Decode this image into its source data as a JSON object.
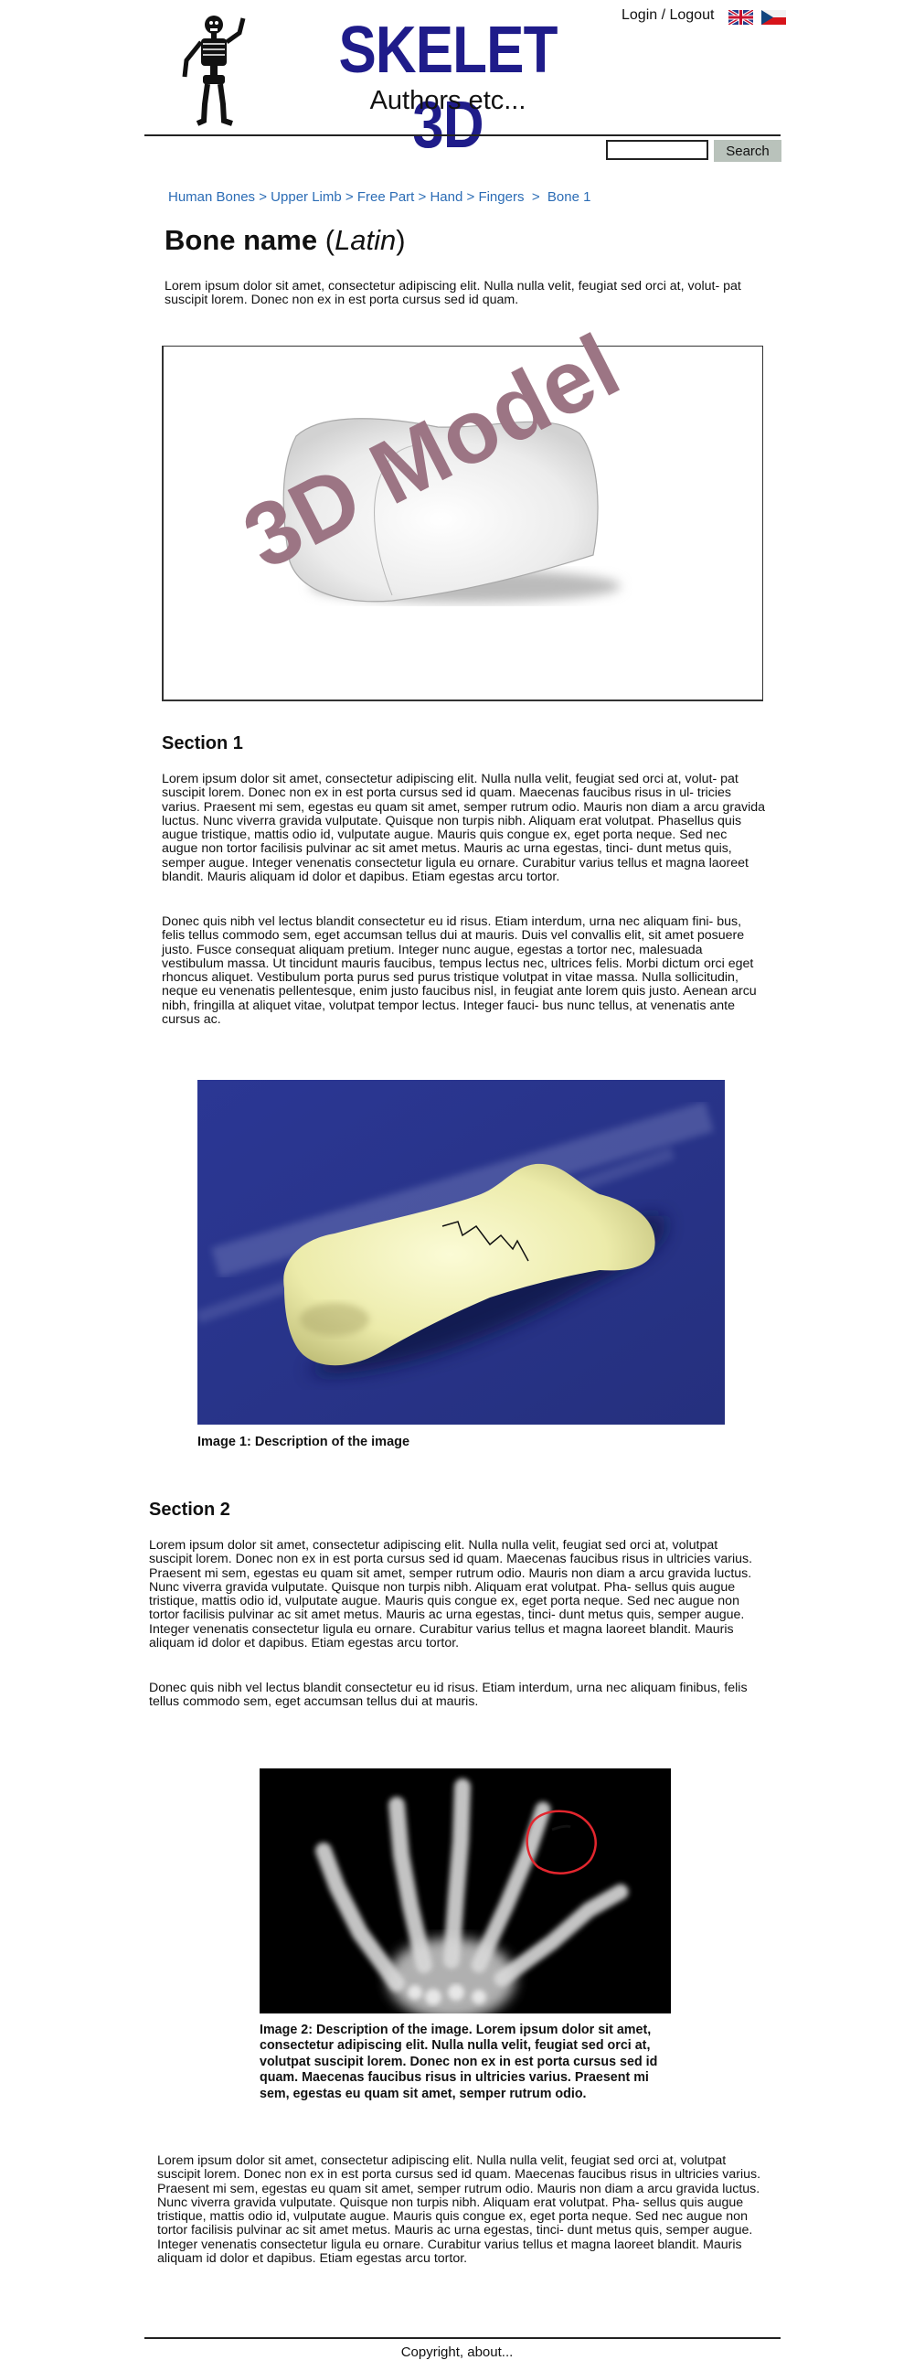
{
  "header": {
    "site_title": "SKELET 3D",
    "subtitle": "Authors etc...",
    "login_label": "Login / Logout",
    "languages": [
      "english-flag-icon",
      "czech-flag-icon"
    ]
  },
  "search": {
    "value": "",
    "placeholder": "",
    "button_label": "Search"
  },
  "breadcrumb": {
    "items": [
      "Human Bones",
      "Upper Limb",
      "Free Part",
      "Hand",
      "Fingers",
      "Bone 1"
    ],
    "separator": ">"
  },
  "bone": {
    "name": "Bone name",
    "latin": "Latin",
    "intro": "Lorem ipsum dolor sit amet, consectetur adipiscing elit. Nulla nulla velit, feugiat sed orci at, volut- pat suscipit lorem. Donec non ex in est porta cursus sed id quam."
  },
  "model": {
    "label": "3D Model"
  },
  "section1": {
    "heading": "Section 1",
    "paragraphs": [
      " Lorem ipsum dolor sit amet, consectetur adipiscing elit. Nulla nulla velit, feugiat sed orci at, volut- pat suscipit lorem. Donec non ex in est porta cursus sed id quam. Maecenas faucibus risus in ul- tricies varius. Praesent mi sem, egestas eu quam sit amet, semper rutrum odio. Mauris non diam a arcu gravida luctus. Nunc viverra gravida vulputate. Quisque non turpis nibh. Aliquam erat volutpat. Phasellus quis augue tristique, mattis odio id, vulputate augue. Mauris quis congue ex, eget porta neque. Sed nec augue non tortor facilisis pulvinar ac sit amet metus. Mauris ac urna egestas, tinci- dunt metus quis, semper augue. Integer venenatis consectetur ligula eu ornare. Curabitur varius tellus et magna laoreet blandit. Mauris aliquam id dolor et dapibus. Etiam egestas arcu tortor.",
      "Donec quis nibh vel lectus blandit consectetur eu id risus. Etiam interdum, urna nec aliquam fini- bus, felis tellus commodo sem, eget accumsan tellus dui at mauris. Duis vel convallis elit, sit amet posuere justo. Fusce consequat aliquam pretium. Integer nunc augue, egestas a tortor nec, malesuada vestibulum massa. Ut tincidunt mauris faucibus, tempus lectus nec, ultrices felis. Morbi dictum orci eget rhoncus aliquet. Vestibulum porta purus sed purus tristique volutpat in vitae massa. Nulla sollicitudin, neque eu venenatis pellentesque, enim justo faucibus nisl, in feugiat ante lorem quis justo. Aenean arcu nibh, fringilla at aliquet vitae, volutpat tempor lectus. Integer fauci- bus nunc tellus, at venenatis ante cursus ac."
    ],
    "image_caption": "Image 1: Description of the image"
  },
  "section2": {
    "heading": "Section 2",
    "paragraphs": [
      " Lorem ipsum dolor sit amet, consectetur adipiscing elit. Nulla nulla velit, feugiat sed orci at, volutpat suscipit lorem. Donec non ex in est porta cursus sed id quam. Maecenas faucibus risus in ultricies varius. Praesent mi sem, egestas eu quam sit amet, semper rutrum odio. Mauris non diam a arcu gravida luctus. Nunc viverra gravida vulputate. Quisque non turpis nibh. Aliquam erat volutpat. Pha- sellus quis augue tristique, mattis odio id, vulputate augue. Mauris quis congue ex, eget porta neque. Sed nec augue non tortor facilisis pulvinar ac sit amet metus. Mauris ac urna egestas, tinci- dunt metus quis, semper augue. Integer venenatis consectetur ligula eu ornare. Curabitur varius tellus et magna laoreet blandit. Mauris aliquam id dolor et dapibus. Etiam egestas arcu tortor.",
      "Donec quis nibh vel lectus blandit consectetur eu id risus. Etiam interdum, urna nec aliquam finibus, felis tellus commodo sem, eget accumsan tellus dui at mauris."
    ],
    "image_caption": "Image 2: Description of the image. Lorem ipsum dolor sit amet, consectetur adipiscing elit. Nulla nulla velit, feugiat sed orci at, volutpat suscipit lorem. Donec non ex in est porta cursus sed id quam. Maecenas faucibus risus in ultricies varius. Praesent mi sem, egestas eu quam sit amet, semper rutrum odio."
  },
  "section3": {
    "paragraphs": [
      " Lorem ipsum dolor sit amet, consectetur adipiscing elit. Nulla nulla velit, feugiat sed orci at, volutpat suscipit lorem. Donec non ex in est porta cursus sed id quam. Maecenas faucibus risus in ultricies varius. Praesent mi sem, egestas eu quam sit amet, semper rutrum odio. Mauris non diam a arcu gravida luctus. Nunc viverra gravida vulputate. Quisque non turpis nibh. Aliquam erat volutpat. Pha- sellus quis augue tristique, mattis odio id, vulputate augue. Mauris quis congue ex, eget porta neque. Sed nec augue non tortor facilisis pulvinar ac sit amet metus. Mauris ac urna egestas, tinci- dunt metus quis, semper augue. Integer venenatis consectetur ligula eu ornare. Curabitur varius tellus et magna laoreet blandit. Mauris aliquam id dolor et dapibus. Etiam egestas arcu tortor."
    ]
  },
  "footer": {
    "text": "Copyright, about..."
  },
  "colors": {
    "title": "#1f1c8a",
    "link": "#2b6cb5",
    "model_label": "#9c7584",
    "search_button": "#b9c2bb",
    "image1_background": "#2f3a8f"
  }
}
